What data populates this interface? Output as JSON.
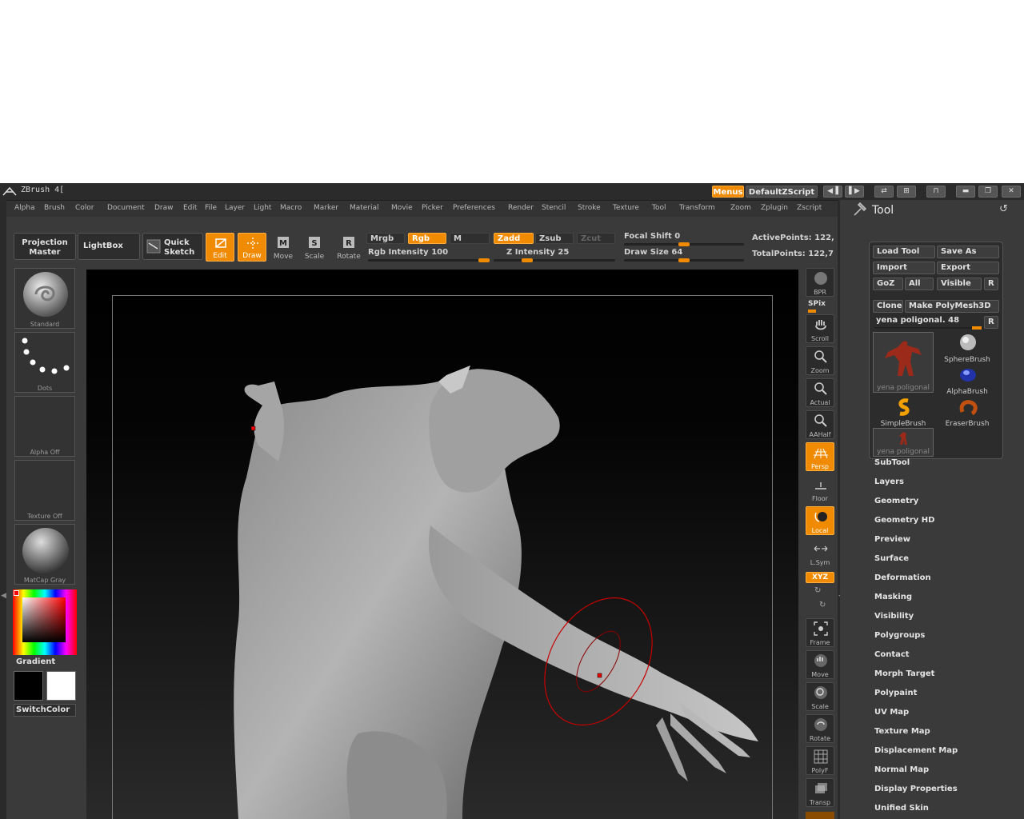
{
  "window": {
    "title": "ZBrush 4[",
    "menus_button": "Menus",
    "script_button": "DefaultZScript"
  },
  "menubar": {
    "items": [
      "Alpha",
      "Brush",
      "Color",
      "Document",
      "Draw",
      "Edit",
      "File",
      "Layer",
      "Light",
      "Macro",
      "Marker",
      "Material",
      "Movie",
      "Picker",
      "Preferences",
      "Render",
      "Stencil",
      "Stroke",
      "Texture",
      "Tool",
      "Transform",
      "Zoom",
      "Zplugin",
      "Zscript"
    ]
  },
  "toolbar": {
    "projection_master": [
      "Projection",
      "Master"
    ],
    "lightbox": "LightBox",
    "quick_sketch": [
      "Quick",
      "Sketch"
    ],
    "modes": [
      "Edit",
      "Draw",
      "Move",
      "Scale",
      "Rotate"
    ],
    "mrgb": "Mrgb",
    "rgb": "Rgb",
    "m": "M",
    "zadd": "Zadd",
    "zsub": "Zsub",
    "zcut": "Zcut",
    "rgb_intensity_label": "Rgb Intensity",
    "rgb_intensity": "100",
    "rgb_intensity_value": 100,
    "z_intensity_label": "Z Intensity",
    "z_intensity": "25",
    "z_intensity_value": 25,
    "focal_shift_label": "Focal Shift",
    "focal_shift": "0",
    "focal_shift_value": 0,
    "draw_size_label": "Draw Size",
    "draw_size": "64",
    "draw_size_value": 64,
    "active_points": "ActivePoints: 122,",
    "total_points": "TotalPoints: 122,7"
  },
  "left_shelf": {
    "brush": "Standard",
    "stroke": "Dots",
    "alpha": "Alpha Off",
    "texture": "Texture Off",
    "material": "MatCap Gray",
    "gradient": "Gradient",
    "switchcolor": "SwitchColor",
    "colors": {
      "main": "#000000",
      "secondary": "#ffffff"
    }
  },
  "right_shelf": {
    "bpr": "BPR",
    "spix": "SPix",
    "buttons": [
      "Scroll",
      "Zoom",
      "Actual",
      "AAHalf",
      "Persp",
      "Floor",
      "Local",
      "L.Sym",
      "Frame",
      "Move",
      "Scale",
      "Rotate",
      "PolyF",
      "Transp"
    ],
    "xyz": "XYZ"
  },
  "tool_palette": {
    "title": "Tool",
    "load_tool": "Load Tool",
    "save_as": "Save As",
    "import": "Import",
    "export": "Export",
    "goz": "GoZ",
    "all": "All",
    "visible": "Visible",
    "r": "R",
    "clone": "Clone",
    "make_polymesh": "Make PolyMesh3D",
    "current_tool": "yena poligonal. 48",
    "current_tool_value": 48,
    "brushes": [
      "yena poligonal",
      "SphereBrush",
      "AlphaBrush",
      "SimpleBrush",
      "EraserBrush",
      "yena poligonal"
    ],
    "subpalettes": [
      "SubTool",
      "Layers",
      "Geometry",
      "Geometry HD",
      "Preview",
      "Surface",
      "Deformation",
      "Masking",
      "Visibility",
      "Polygroups",
      "Contact",
      "Morph Target",
      "Polypaint",
      "UV Map",
      "Texture Map",
      "Displacement Map",
      "Normal Map",
      "Display Properties",
      "Unified Skin"
    ]
  },
  "accent": "#f08a00"
}
